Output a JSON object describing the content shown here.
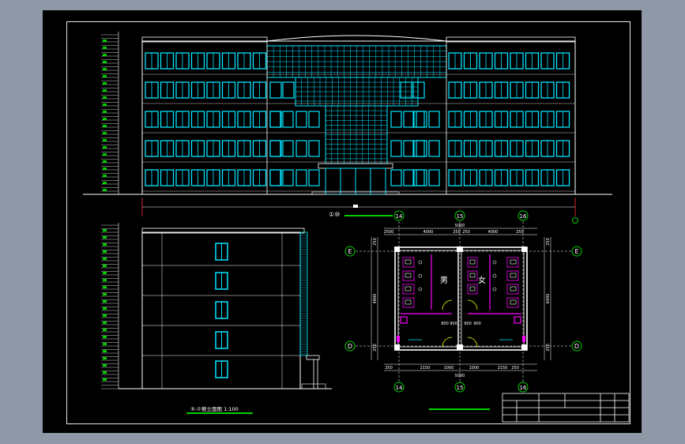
{
  "drawing": {
    "side_elevation_title": "⑤-①侧立面图 1:100",
    "plan": {
      "axis_top": [
        "14",
        "15",
        "16"
      ],
      "axis_side": [
        "E",
        "D"
      ],
      "room_male": "男",
      "room_female": "女",
      "dim_total_top": "5000",
      "dim_top_parts": [
        "2500",
        "4000",
        "250",
        "250",
        "4000",
        "250"
      ],
      "dim_total_bottom": "5000",
      "dim_bottom_parts": [
        "250",
        "2150",
        "1000",
        "1000",
        "2150",
        "250"
      ],
      "dim_mid": [
        "900",
        "900",
        "900",
        "900"
      ],
      "dim_left": [
        "250",
        "4800",
        "250"
      ],
      "dim_right": [
        "250",
        "6400",
        "250"
      ]
    },
    "front_scale_label": "①⑩"
  },
  "colors": {
    "background": "#8f98a6",
    "paper": "#000000",
    "line": "#ffffff",
    "window": "#00e5ff",
    "accent_green": "#00d000",
    "magenta": "#ff00ff",
    "yellow": "#ffff00"
  }
}
